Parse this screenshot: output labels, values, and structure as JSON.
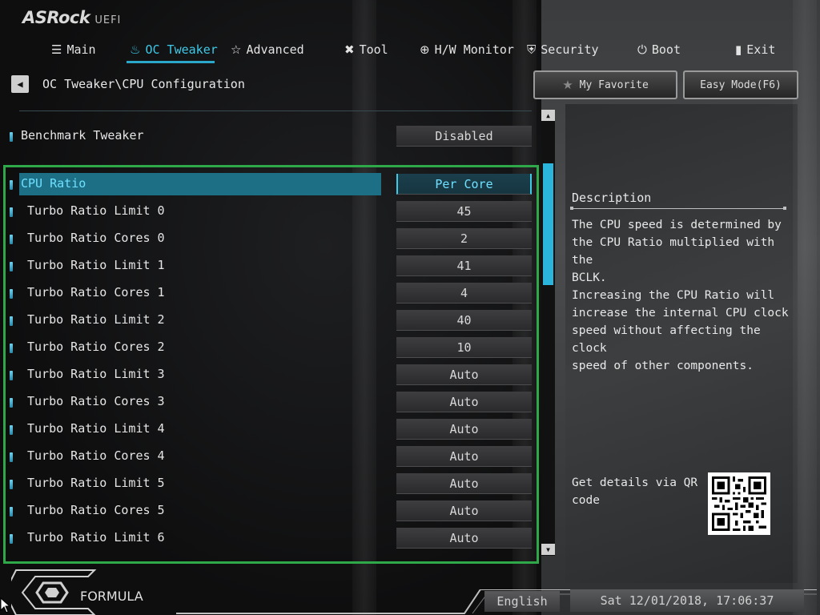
{
  "app": {
    "logo": "ASRock",
    "logo_sub": "UEFI"
  },
  "tabs": [
    {
      "label": "Main",
      "icon": "list-icon"
    },
    {
      "label": "OC Tweaker",
      "icon": "flame-icon",
      "active": true
    },
    {
      "label": "Advanced",
      "icon": "star-outline-icon"
    },
    {
      "label": "Tool",
      "icon": "tools-icon"
    },
    {
      "label": "H/W Monitor",
      "icon": "crosshair-icon"
    },
    {
      "label": "Security",
      "icon": "shield-icon"
    },
    {
      "label": "Boot",
      "icon": "power-icon"
    },
    {
      "label": "Exit",
      "icon": "exit-door-icon"
    }
  ],
  "breadcrumb": "OC Tweaker\\CPU Configuration",
  "top_buttons": {
    "favorite": "My Favorite",
    "easy_mode": "Easy Mode(F6)"
  },
  "benchmark": {
    "label": "Benchmark Tweaker",
    "value": "Disabled"
  },
  "settings": [
    {
      "label": "CPU Ratio",
      "value": "Per Core",
      "selected": true
    },
    {
      "label": "Turbo Ratio Limit 0",
      "value": "45"
    },
    {
      "label": "Turbo Ratio Cores 0",
      "value": "2"
    },
    {
      "label": "Turbo Ratio Limit 1",
      "value": "41"
    },
    {
      "label": "Turbo Ratio Cores 1",
      "value": "4"
    },
    {
      "label": "Turbo Ratio Limit 2",
      "value": "40"
    },
    {
      "label": "Turbo Ratio Cores 2",
      "value": "10"
    },
    {
      "label": "Turbo Ratio Limit 3",
      "value": "Auto"
    },
    {
      "label": "Turbo Ratio Cores 3",
      "value": "Auto"
    },
    {
      "label": "Turbo Ratio Limit 4",
      "value": "Auto"
    },
    {
      "label": "Turbo Ratio Cores 4",
      "value": "Auto"
    },
    {
      "label": "Turbo Ratio Limit 5",
      "value": "Auto"
    },
    {
      "label": "Turbo Ratio Cores 5",
      "value": "Auto"
    },
    {
      "label": "Turbo Ratio Limit 6",
      "value": "Auto"
    }
  ],
  "description": {
    "title": "Description",
    "text": "The CPU speed is determined by\nthe CPU Ratio multiplied with the\nBCLK.\nIncreasing the CPU Ratio will\nincrease the internal CPU clock\nspeed without affecting the clock\nspeed of other components.",
    "qr_label": "Get details via QR code"
  },
  "footer": {
    "brand": "FORMULA",
    "language": "English",
    "datetime": "Sat 12/01/2018, 17:06:37"
  },
  "colors": {
    "accent": "#3ec9e8",
    "selection": "#1d6f85",
    "focus_box": "#2fa84a"
  }
}
